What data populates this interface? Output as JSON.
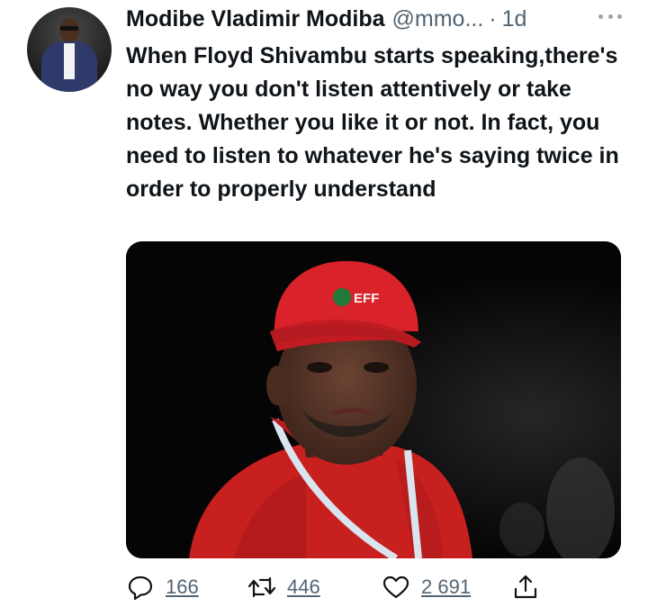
{
  "author": {
    "name": "Modibe Vladimir Modiba",
    "handle": "@mmo...",
    "separator": "·",
    "time": "1d"
  },
  "tweet": {
    "text": "When Floyd Shivambu starts speaking,there's no way you don't listen attentively or take notes. Whether you like it or not. In fact, you need to listen to whatever he's saying twice in order to properly understand"
  },
  "media": {
    "cap_text": "EFF"
  },
  "actions": {
    "replies": "166",
    "retweets": "446",
    "likes": "2 691"
  },
  "icons": {
    "reply": "reply-icon",
    "retweet": "retweet-icon",
    "like": "heart-icon",
    "share": "share-icon",
    "more": "more-icon"
  },
  "colors": {
    "text": "#0f1419",
    "secondary": "#536471",
    "cap_red": "#d9222a",
    "shirt_red": "#c8201f"
  }
}
